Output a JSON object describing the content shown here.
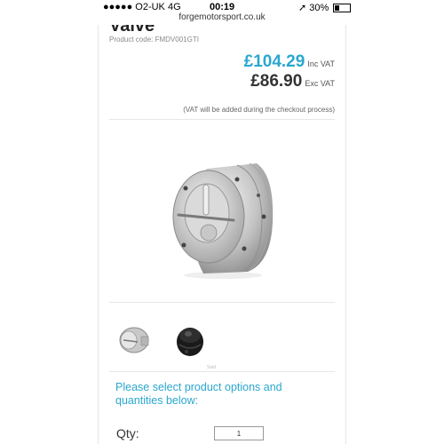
{
  "status_bar": {
    "carrier": "●●●●● O2-UK  4G",
    "time": "00:19",
    "battery_text": "30%",
    "battery_level": 0.3
  },
  "browser": {
    "url": "forgemotorsport.co.uk"
  },
  "product": {
    "title_fragment": "Valve",
    "code": "Product code: FMDV001GTI",
    "price_inc": "£104.29",
    "price_inc_tag": "Inc VAT",
    "price_exc": "£86.90",
    "price_exc_tag": "Exc VAT",
    "vat_note": "(VAT will be added during the checkout process)",
    "thumbnail_caption": "Sold"
  },
  "options": {
    "message": "Please select product options and quantities below:",
    "qty_label": "Qty:",
    "qty_value": "1"
  },
  "colors": {
    "accent": "#2aa7cf",
    "text": "#333333"
  },
  "icons": [
    "location-arrow-icon",
    "battery-icon",
    "signal-dots-icon"
  ]
}
